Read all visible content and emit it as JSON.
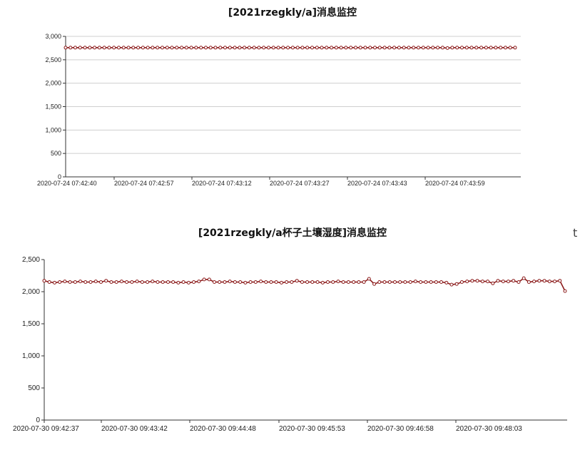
{
  "stray_glyph": "t",
  "chart_data": [
    {
      "type": "line",
      "title": "[2021rzegkly/a]消息监控",
      "xlabel": "",
      "ylabel": "",
      "ylim": [
        0,
        3000
      ],
      "yticks": [
        "0",
        "500",
        "1,000",
        "1,500",
        "2,000",
        "2,500",
        "3,000"
      ],
      "ytick_values": [
        0,
        500,
        1000,
        1500,
        2000,
        2500,
        3000
      ],
      "xtick_labels": [
        "2020-07-24 07:42:40",
        "2020-07-24 07:42:57",
        "2020-07-24 07:43:12",
        "2020-07-24 07:43:27",
        "2020-07-24 07:43:43",
        "2020-07-24 07:43:59"
      ],
      "grid": true,
      "series": [
        {
          "color": "#8b1a1a",
          "values": [
            2760,
            2760,
            2760,
            2760,
            2760,
            2760,
            2760,
            2760,
            2760,
            2760,
            2760,
            2760,
            2760,
            2760,
            2760,
            2760,
            2760,
            2760,
            2760,
            2760,
            2760,
            2760,
            2760,
            2760,
            2760,
            2760,
            2760,
            2760,
            2760,
            2760,
            2760,
            2760,
            2760,
            2760,
            2760,
            2760,
            2760,
            2760,
            2760,
            2760,
            2760,
            2760,
            2760,
            2760,
            2760,
            2760,
            2760,
            2760,
            2760,
            2760,
            2760,
            2760,
            2760,
            2760,
            2760,
            2760,
            2760,
            2760,
            2760,
            2760,
            2760,
            2760,
            2760,
            2760,
            2760,
            2760,
            2760,
            2760,
            2760,
            2760,
            2760,
            2760,
            2760,
            2760,
            2760,
            2760,
            2760,
            2760,
            2760,
            2750,
            2760,
            2760,
            2760,
            2760,
            2760,
            2760,
            2760,
            2760,
            2760,
            2760,
            2760,
            2760,
            2760,
            2760
          ]
        }
      ]
    },
    {
      "type": "line",
      "title": "[2021rzegkly/a杯子土壤湿度]消息监控",
      "xlabel": "",
      "ylabel": "",
      "ylim": [
        0,
        2500
      ],
      "yticks": [
        "0",
        "500",
        "1,000",
        "1,500",
        "2,000",
        "2,500"
      ],
      "ytick_values": [
        0,
        500,
        1000,
        1500,
        2000,
        2500
      ],
      "xtick_labels": [
        "2020-07-30 09:42:37",
        "2020-07-30 09:43:42",
        "2020-07-30 09:44:48",
        "2020-07-30 09:45:53",
        "2020-07-30 09:46:58",
        "2020-07-30 09:48:03"
      ],
      "grid": false,
      "series": [
        {
          "color": "#8b1a1a",
          "values": [
            2170,
            2150,
            2140,
            2150,
            2160,
            2150,
            2150,
            2160,
            2150,
            2150,
            2160,
            2150,
            2170,
            2150,
            2150,
            2160,
            2150,
            2150,
            2160,
            2150,
            2150,
            2160,
            2150,
            2150,
            2150,
            2150,
            2140,
            2150,
            2140,
            2150,
            2160,
            2190,
            2190,
            2150,
            2150,
            2150,
            2160,
            2150,
            2150,
            2140,
            2150,
            2150,
            2160,
            2150,
            2150,
            2150,
            2140,
            2150,
            2150,
            2170,
            2150,
            2150,
            2150,
            2150,
            2140,
            2150,
            2150,
            2160,
            2150,
            2150,
            2150,
            2150,
            2150,
            2200,
            2120,
            2150,
            2150,
            2150,
            2150,
            2150,
            2150,
            2150,
            2160,
            2150,
            2150,
            2150,
            2150,
            2150,
            2140,
            2110,
            2120,
            2150,
            2160,
            2170,
            2170,
            2160,
            2160,
            2130,
            2170,
            2160,
            2160,
            2170,
            2150,
            2210,
            2150,
            2160,
            2170,
            2170,
            2160,
            2160,
            2170,
            2010
          ]
        }
      ]
    }
  ]
}
